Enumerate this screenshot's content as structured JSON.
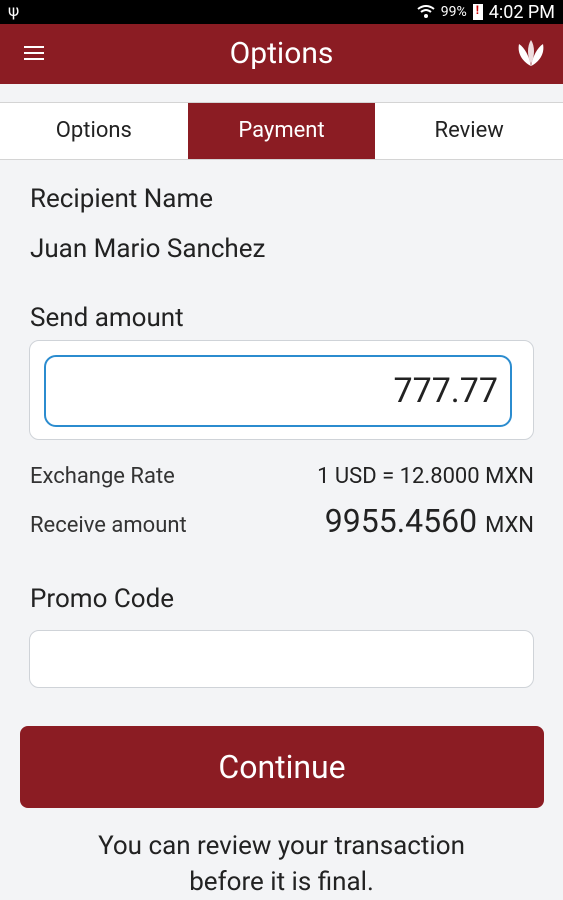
{
  "status_bar": {
    "battery_percent": "99%",
    "time": "4:02 PM"
  },
  "app_bar": {
    "title": "Options"
  },
  "tabs": [
    {
      "label": "Options",
      "active": false
    },
    {
      "label": "Payment",
      "active": true
    },
    {
      "label": "Review",
      "active": false
    }
  ],
  "form": {
    "recipient_label": "Recipient Name",
    "recipient_name": "Juan Mario Sanchez",
    "send_amount_label": "Send amount",
    "send_amount_value": "777.77",
    "exchange_rate_label": "Exchange Rate",
    "exchange_rate_value": "1 USD = 12.8000 MXN",
    "receive_amount_label": "Receive amount",
    "receive_amount_value": "9955.4560",
    "receive_currency": "MXN",
    "promo_label": "Promo Code",
    "promo_value": ""
  },
  "continue_label": "Continue",
  "note_line1": "You can review your transaction",
  "note_line2": "before it is final.",
  "colors": {
    "brand": "#8b1c23",
    "input_focus": "#2b8ccf"
  }
}
